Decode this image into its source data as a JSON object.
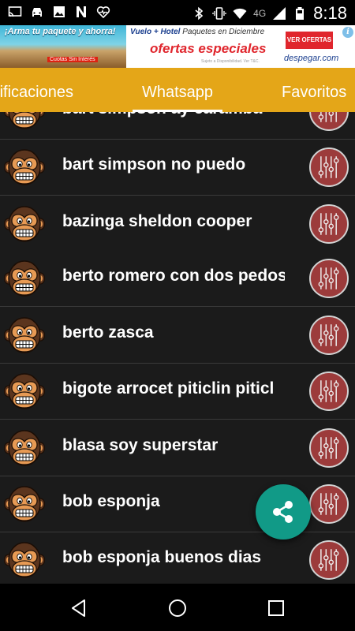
{
  "status_bar": {
    "left_icons": [
      "cast-icon",
      "car-icon",
      "image-icon",
      "n-icon",
      "heart-pulse-icon"
    ],
    "right_icons": [
      "bluetooth-icon",
      "vibrate-icon",
      "wifi-icon",
      "cell-signal-icon",
      "battery-icon"
    ],
    "network_label": "4G",
    "time": "8:18"
  },
  "ad": {
    "slogan": "¡Arma tu paquete y ahorra!",
    "cuotas": "Cuotas Sin Interés",
    "top_line": "Vuelo + Hotel",
    "top_line_sub": "Paquetes en Diciembre",
    "offers": "ofertas especiales",
    "cta": "VER OFERTAS",
    "brand": "despegar.com",
    "fineprint": "Sujeto a Disponibilidad. Ver T&C.",
    "info": "i"
  },
  "tabs": {
    "left": "Notificaciones",
    "center": "Whatsapp",
    "right": "Favoritos"
  },
  "rows": [
    {
      "title": "bart simpson ay caramba"
    },
    {
      "title": "bart simpson no puedo"
    },
    {
      "title": "bazinga sheldon cooper"
    },
    {
      "title": "berto romero con dos pedos"
    },
    {
      "title": "berto zasca"
    },
    {
      "title": "bigote arrocet piticlin piticl"
    },
    {
      "title": "blasa soy superstar"
    },
    {
      "title": "bob esponja"
    },
    {
      "title": "bob esponja buenos dias"
    }
  ],
  "colors": {
    "tab_bar": "#e4a618",
    "list_bg": "#1b1b1b",
    "eq_button": "#9c3b3b",
    "fab": "#119a87",
    "monkey_face": "#e79a54",
    "monkey_fur": "#5b351e"
  },
  "icons": {
    "fab": "share-icon",
    "row_left": "monkey-icon",
    "row_right": "equalizer-icon",
    "nav": [
      "back-icon",
      "home-icon",
      "recents-icon"
    ]
  }
}
